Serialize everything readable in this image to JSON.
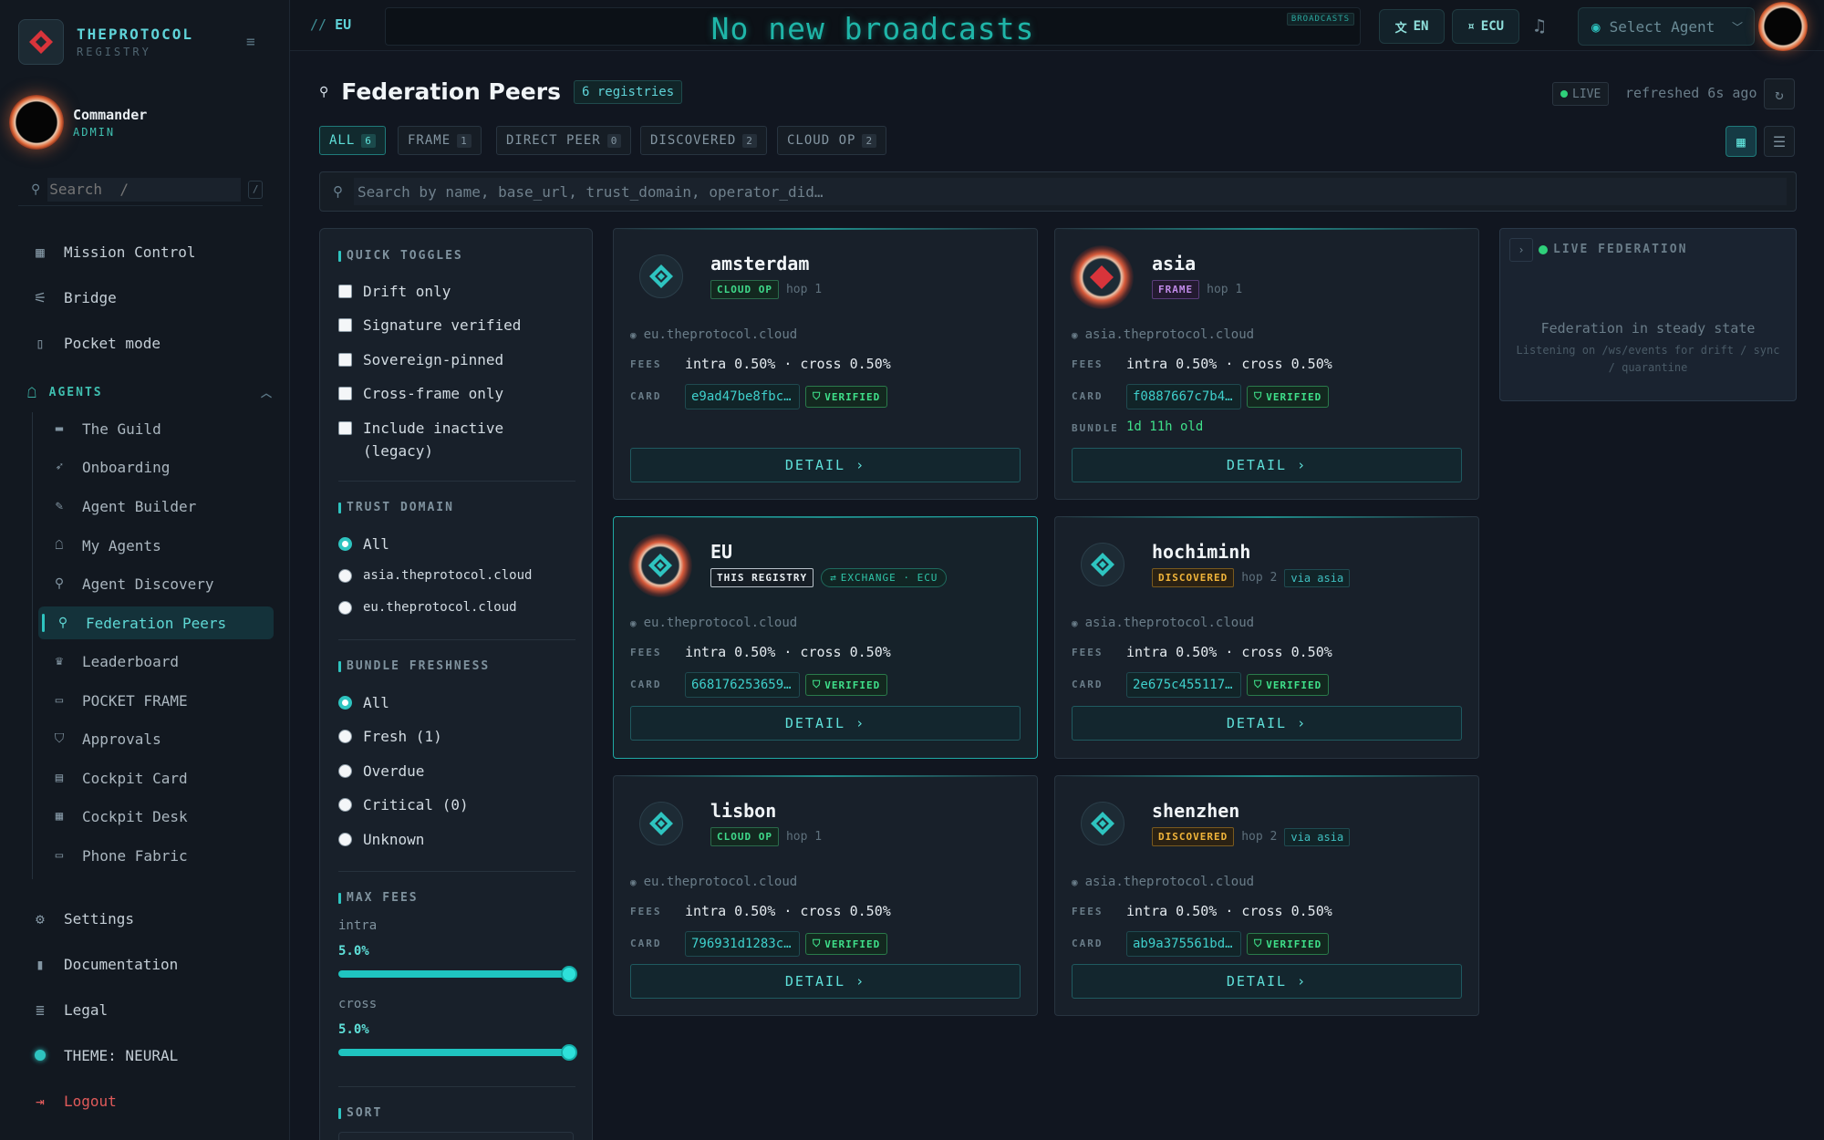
{
  "brand": {
    "name": "THEPROTOCOL",
    "sub": "REGISTRY"
  },
  "user": {
    "name": "Commander",
    "role": "ADMIN"
  },
  "sidebar": {
    "search_placeholder": "Search  /",
    "search_kbd": "/",
    "top_items": [
      {
        "label": "Mission Control",
        "icon": "grid-icon"
      },
      {
        "label": "Bridge",
        "icon": "bridge-icon"
      },
      {
        "label": "Pocket mode",
        "icon": "phone-icon"
      }
    ],
    "agents_group_label": "AGENTS",
    "agent_items": [
      {
        "label": "The Guild",
        "icon": "briefcase-icon"
      },
      {
        "label": "Onboarding",
        "icon": "rocket-icon"
      },
      {
        "label": "Agent Builder",
        "icon": "wrench-icon"
      },
      {
        "label": "My Agents",
        "icon": "robot-icon"
      },
      {
        "label": "Agent Discovery",
        "icon": "search-icon"
      },
      {
        "label": "Federation Peers",
        "icon": "federation-icon"
      },
      {
        "label": "Leaderboard",
        "icon": "trophy-icon"
      },
      {
        "label": "POCKET FRAME",
        "icon": "devices-icon"
      },
      {
        "label": "Approvals",
        "icon": "shield-check-icon"
      },
      {
        "label": "Cockpit Card",
        "icon": "id-card-icon"
      },
      {
        "label": "Cockpit Desk",
        "icon": "grid-small-icon"
      },
      {
        "label": "Phone Fabric",
        "icon": "monitor-icon"
      }
    ],
    "bottom_items": [
      {
        "label": "Settings",
        "icon": "gear-icon"
      },
      {
        "label": "Documentation",
        "icon": "book-icon"
      },
      {
        "label": "Legal",
        "icon": "document-icon"
      },
      {
        "label": "THEME: NEURAL",
        "icon": "theme-dot-icon"
      },
      {
        "label": "Logout",
        "icon": "logout-icon"
      }
    ]
  },
  "topbar": {
    "crumb_prefix": "//",
    "crumb": "EU",
    "broadcast": "No new broadcasts",
    "broadcast_tag": "BROADCASTS",
    "lang": "EN",
    "currency": "ECU",
    "agent_select": "Select Agent"
  },
  "page": {
    "title": "Federation Peers",
    "registry_count": "6 registries",
    "live": "LIVE",
    "refreshed": "refreshed 6s ago",
    "search_placeholder": "Search by name, base_url, trust_domain, operator_did…",
    "tabs": [
      {
        "label": "ALL",
        "count": "6"
      },
      {
        "label": "FRAME",
        "count": "1"
      },
      {
        "label": "DIRECT PEER",
        "count": "0"
      },
      {
        "label": "DISCOVERED",
        "count": "2"
      },
      {
        "label": "CLOUD OP",
        "count": "2"
      }
    ]
  },
  "filters": {
    "quick_toggles_title": "QUICK TOGGLES",
    "toggles": [
      "Drift only",
      "Signature verified",
      "Sovereign-pinned",
      "Cross-frame only",
      "Include inactive (legacy)"
    ],
    "trust_domain_title": "TRUST DOMAIN",
    "trust_domains": [
      "All",
      "asia.theprotocol.cloud",
      "eu.theprotocol.cloud"
    ],
    "freshness_title": "BUNDLE FRESHNESS",
    "freshness": [
      "All",
      "Fresh (1)",
      "Overdue",
      "Critical (0)",
      "Unknown"
    ],
    "max_fees_title": "MAX FEES",
    "intra_label": "intra",
    "intra_value": "5.0%",
    "intra_level": 1.0,
    "cross_label": "cross",
    "cross_value": "5.0%",
    "cross_level": 1.0,
    "sort_title": "SORT"
  },
  "card_labels": {
    "fees": "FEES",
    "card": "CARD",
    "bundle": "BUNDLE",
    "detail": "DETAIL ›",
    "verified": "VERIFIED"
  },
  "peers": [
    {
      "name": "amsterdam",
      "type": "CLOUD OP",
      "hop": "hop 1",
      "domain": "eu.theprotocol.cloud",
      "fees": "intra 0.50% · cross 0.50%",
      "card": "e9ad47be8fbc…"
    },
    {
      "name": "asia",
      "type": "FRAME",
      "hop": "hop 1",
      "domain": "asia.theprotocol.cloud",
      "fees": "intra 0.50% · cross 0.50%",
      "card": "f0887667c7b4…",
      "bundle": "1d 11h old"
    },
    {
      "name": "EU",
      "type": "THIS REGISTRY",
      "exchange": "EXCHANGE · ECU",
      "domain": "eu.theprotocol.cloud",
      "fees": "intra 0.50% · cross 0.50%",
      "card": "668176253659…"
    },
    {
      "name": "hochiminh",
      "type": "DISCOVERED",
      "hop": "hop 2",
      "via": "via asia",
      "domain": "asia.theprotocol.cloud",
      "fees": "intra 0.50% · cross 0.50%",
      "card": "2e675c455117…"
    },
    {
      "name": "lisbon",
      "type": "CLOUD OP",
      "hop": "hop 1",
      "domain": "eu.theprotocol.cloud",
      "fees": "intra 0.50% · cross 0.50%",
      "card": "796931d1283c…"
    },
    {
      "name": "shenzhen",
      "type": "DISCOVERED",
      "hop": "hop 2",
      "via": "via asia",
      "domain": "asia.theprotocol.cloud",
      "fees": "intra 0.50% · cross 0.50%",
      "card": "ab9a375561bd…"
    }
  ],
  "live_federation": {
    "title": "LIVE FEDERATION",
    "state": "Federation in steady state",
    "listening": "Listening on /ws/events for drift / sync / quarantine"
  }
}
